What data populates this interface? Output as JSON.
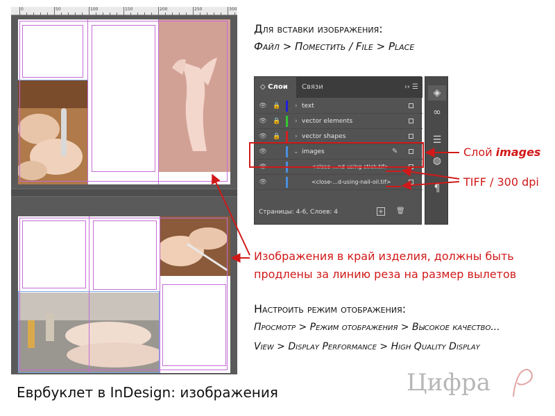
{
  "ruler": {
    "labels": [
      "0",
      "50",
      "100",
      "150",
      "200",
      "250",
      "300"
    ]
  },
  "layers_panel": {
    "tabs": [
      {
        "label": "◇ Слои",
        "active": true
      },
      {
        "label": "Связи",
        "active": false
      }
    ],
    "menu": "›› ☰",
    "rows": [
      {
        "name": "text",
        "color": "#1f1fd6",
        "locked": true,
        "expand": "›"
      },
      {
        "name": "vector elements",
        "color": "#32c832",
        "locked": true,
        "expand": "›"
      },
      {
        "name": "vector shapes",
        "color": "#d32020",
        "locked": true,
        "expand": "›"
      },
      {
        "name": "images",
        "color": "#4a8fe0",
        "locked": false,
        "expand": "⌄",
        "selected": true
      },
      {
        "name": "<close-...nd-using-stick.tif>",
        "color": "#4a8fe0",
        "locked": false
      },
      {
        "name": "<close-...d-using-nail-oil.tif>",
        "color": "#4a8fe0",
        "locked": false
      }
    ],
    "status": "Страницы: 4-6, Слоев: 4",
    "new_layer_icon": "new-layer-icon",
    "delete_icon": "trash-icon"
  },
  "dock_icons": [
    "layers-icon",
    "links-icon",
    "menu-icon",
    "swatches-icon",
    "paragraph-icon"
  ],
  "annotations": {
    "insert_title": "Для вставки изображения:",
    "insert_path": "Файл > Поместить / File > Place",
    "layer_images_prefix": "Слой ",
    "layer_images_name": "images",
    "tiff_label": "TIFF / 300 dpi",
    "bleed_line1": "Изображения в край изделия, должны быть",
    "bleed_line2": "продлены за линию реза на размер вылетов",
    "display_title": "Настроить режим отображения:",
    "display_path_ru": "Просмотр > Режим отображения > Высокое качество...",
    "display_path_en": "View > Display Performance > High Quality Display",
    "caption": "Еврбуклет в InDesign: изображения",
    "logo": "Цифра"
  },
  "colors": {
    "accent_red": "#d11919",
    "guide_magenta": "#c26bd6",
    "guide_blue": "#7aa7e8"
  }
}
